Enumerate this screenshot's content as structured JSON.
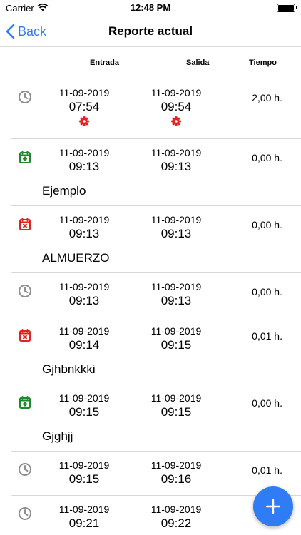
{
  "status": {
    "carrier": "Carrier",
    "time": "12:48 PM"
  },
  "nav": {
    "back_label": "Back",
    "title": "Reporte actual"
  },
  "header": {
    "entrada": "Entrada",
    "salida": "Salida",
    "tiempo": "Tiempo"
  },
  "colors": {
    "accent": "#2f7cf6",
    "green": "#1e8a2c",
    "red": "#e0231f",
    "gray": "#8e8e93"
  },
  "rows": [
    {
      "icon": "clock-icon",
      "in_date": "11-09-2019",
      "in_time": "07:54",
      "out_date": "11-09-2019",
      "out_time": "09:54",
      "duration": "2,00 h.",
      "note": ""
    },
    {
      "icon": "calendar-plus-icon",
      "in_date": "11-09-2019",
      "in_time": "09:13",
      "out_date": "11-09-2019",
      "out_time": "09:13",
      "duration": "0,00 h.",
      "note": "Ejemplo"
    },
    {
      "icon": "calendar-x-icon",
      "in_date": "11-09-2019",
      "in_time": "09:13",
      "out_date": "11-09-2019",
      "out_time": "09:13",
      "duration": "0,00 h.",
      "note": "ALMUERZO"
    },
    {
      "icon": "clock-icon",
      "in_date": "11-09-2019",
      "in_time": "09:13",
      "out_date": "11-09-2019",
      "out_time": "09:13",
      "duration": "0,00 h.",
      "note": ""
    },
    {
      "icon": "calendar-x-icon",
      "in_date": "11-09-2019",
      "in_time": "09:14",
      "out_date": "11-09-2019",
      "out_time": "09:15",
      "duration": "0,01 h.",
      "note": "Gjhbnkkki"
    },
    {
      "icon": "calendar-plus-icon",
      "in_date": "11-09-2019",
      "in_time": "09:15",
      "out_date": "11-09-2019",
      "out_time": "09:15",
      "duration": "0,00 h.",
      "note": "Gjghjj"
    },
    {
      "icon": "clock-icon",
      "in_date": "11-09-2019",
      "in_time": "09:15",
      "out_date": "11-09-2019",
      "out_time": "09:16",
      "duration": "0,01 h.",
      "note": ""
    },
    {
      "icon": "clock-icon",
      "in_date": "11-09-2019",
      "in_time": "09:21",
      "out_date": "11-09-2019",
      "out_time": "09:22",
      "duration": "",
      "note": ""
    }
  ]
}
